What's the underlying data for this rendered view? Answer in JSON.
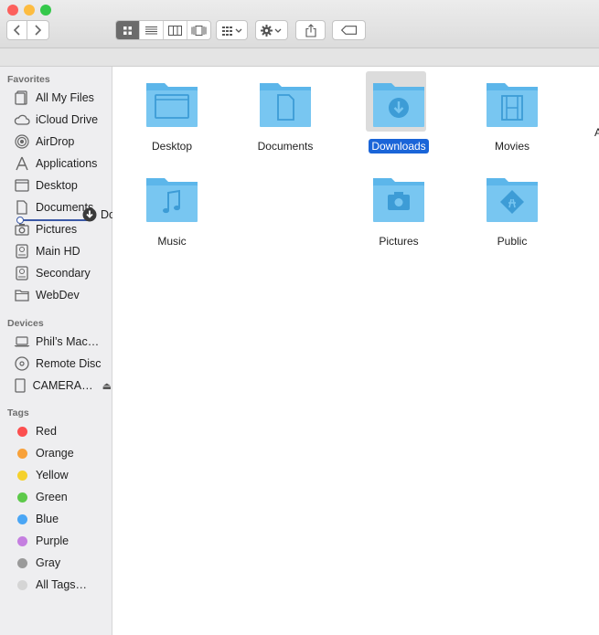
{
  "colors": {
    "accent": "#1a65d8",
    "folder": "#6ec1ef",
    "close": "#fc605c",
    "minimize": "#fdbc40",
    "zoom": "#34c84a"
  },
  "toolbar": {
    "back_icon": "chevron-left-icon",
    "forward_icon": "chevron-right-icon",
    "view_modes": [
      "icon-view",
      "list-view",
      "column-view",
      "cover-flow-view"
    ],
    "selected_view": "icon-view",
    "arrange_icon": "arrange-grid-icon",
    "action_icon": "gear-icon",
    "share_icon": "share-icon",
    "tag_icon": "tag-icon"
  },
  "sidebar": {
    "favorites_heading": "Favorites",
    "favorites": [
      {
        "label": "All My Files",
        "icon": "all-files-icon"
      },
      {
        "label": "iCloud Drive",
        "icon": "cloud-icon"
      },
      {
        "label": "AirDrop",
        "icon": "airdrop-icon"
      },
      {
        "label": "Applications",
        "icon": "applications-icon"
      },
      {
        "label": "Desktop",
        "icon": "desktop-icon"
      },
      {
        "label": "Documents",
        "icon": "document-icon"
      },
      {
        "label": "Pictures",
        "icon": "camera-icon"
      },
      {
        "label": "Main HD",
        "icon": "harddrive-icon"
      },
      {
        "label": "Secondary",
        "icon": "harddrive-icon"
      },
      {
        "label": "WebDev",
        "icon": "folder-icon"
      }
    ],
    "devices_heading": "Devices",
    "devices": [
      {
        "label": "Phil’s Mac…",
        "icon": "laptop-icon"
      },
      {
        "label": "Remote Disc",
        "icon": "disc-icon"
      },
      {
        "label": "CAMERA…",
        "icon": "drive-icon",
        "eject": "⏏"
      }
    ],
    "tags_heading": "Tags",
    "tags": [
      {
        "label": "Red",
        "color": "#fc4f4f"
      },
      {
        "label": "Orange",
        "color": "#f8a13a"
      },
      {
        "label": "Yellow",
        "color": "#f5d12c"
      },
      {
        "label": "Green",
        "color": "#5dc94a"
      },
      {
        "label": "Blue",
        "color": "#4aa6f5"
      },
      {
        "label": "Purple",
        "color": "#c57fe0"
      },
      {
        "label": "Gray",
        "color": "#9a9a9a"
      },
      {
        "label": "All Tags…",
        "color": "#d5d5d5"
      }
    ]
  },
  "drag": {
    "label": "Downloads",
    "icon": "download-icon"
  },
  "folders": [
    {
      "name": "Desktop",
      "glyph": "window"
    },
    {
      "name": "Documents",
      "glyph": "document"
    },
    {
      "name": "Downloads",
      "glyph": "download",
      "selected": true
    },
    {
      "name": "Movies",
      "glyph": "film"
    },
    {
      "name": "Music",
      "glyph": "music"
    },
    {
      "name": "Pictures",
      "glyph": "camera"
    },
    {
      "name": "Public",
      "glyph": "public"
    }
  ]
}
